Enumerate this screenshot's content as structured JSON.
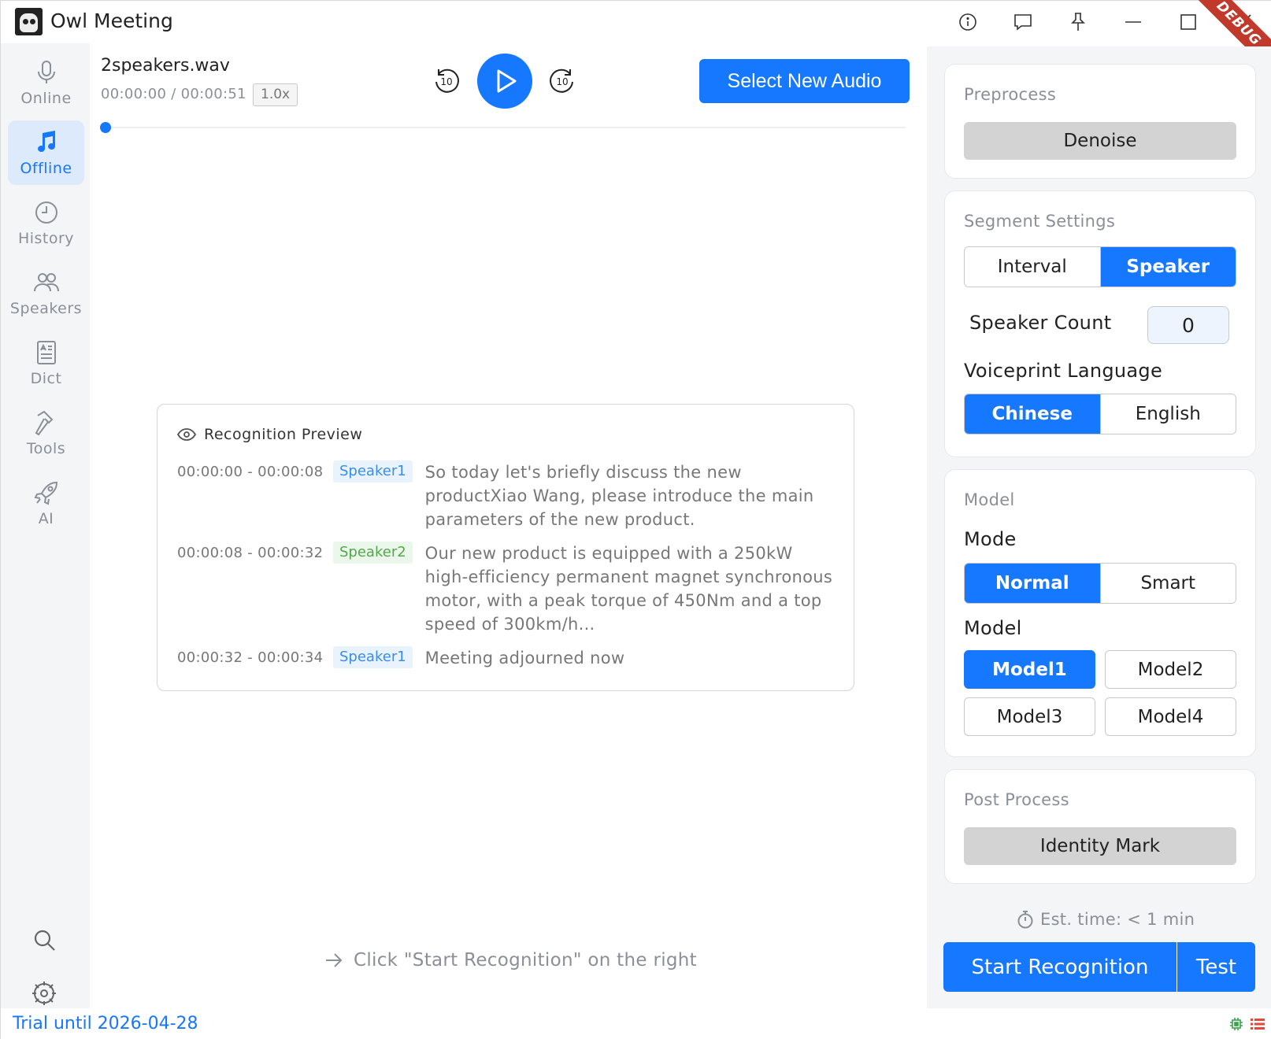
{
  "app": {
    "title": "Owl Meeting",
    "debug_label": "DEBUG"
  },
  "sidebar": {
    "items": [
      {
        "label": "Online",
        "icon": "microphone-icon",
        "active": false
      },
      {
        "label": "Offline",
        "icon": "music-note-icon",
        "active": true
      },
      {
        "label": "History",
        "icon": "clock-icon",
        "active": false
      },
      {
        "label": "Speakers",
        "icon": "users-icon",
        "active": false
      },
      {
        "label": "Dict",
        "icon": "dictionary-icon",
        "active": false
      },
      {
        "label": "Tools",
        "icon": "hammer-icon",
        "active": false
      },
      {
        "label": "AI",
        "icon": "rocket-icon",
        "active": false
      }
    ]
  },
  "player": {
    "file_name": "2speakers.wav",
    "time": "00:00:00 / 00:00:51",
    "speed": "1.0x",
    "skip_back_label": "10",
    "skip_forward_label": "10",
    "select_audio_label": "Select New Audio",
    "progress": 0
  },
  "preview": {
    "title": "Recognition Preview",
    "segments": [
      {
        "time": "00:00:00 - 00:00:08",
        "speaker": "Speaker1",
        "text": "So today let's briefly discuss the new productXiao Wang, please introduce the main parameters of the new product."
      },
      {
        "time": "00:00:08 - 00:00:32",
        "speaker": "Speaker2",
        "text": "Our new product is equipped with a 250kW high-efficiency permanent magnet synchronous motor, with a peak torque of 450Nm and a top speed of 300km/h..."
      },
      {
        "time": "00:00:32 - 00:00:34",
        "speaker": "Speaker1",
        "text": "Meeting adjourned now"
      }
    ]
  },
  "hint": "Click \"Start Recognition\" on the right",
  "panel": {
    "preprocess": {
      "title": "Preprocess",
      "denoise_label": "Denoise"
    },
    "segment": {
      "title": "Segment Settings",
      "options": [
        "Interval",
        "Speaker"
      ],
      "selected": "Speaker",
      "speaker_count_label": "Speaker Count",
      "speaker_count": "0",
      "voiceprint_label": "Voiceprint Language",
      "languages": [
        "Chinese",
        "English"
      ],
      "selected_language": "Chinese"
    },
    "model": {
      "title": "Model",
      "mode_label": "Mode",
      "modes": [
        "Normal",
        "Smart"
      ],
      "selected_mode": "Normal",
      "model_label": "Model",
      "models": [
        "Model1",
        "Model2",
        "Model3",
        "Model4"
      ],
      "selected_model": "Model1"
    },
    "post": {
      "title": "Post Process",
      "identity_label": "Identity Mark"
    },
    "est_time": "Est. time: < 1 min",
    "start_label": "Start Recognition",
    "test_label": "Test"
  },
  "status": {
    "trial": "Trial until 2026-04-28"
  },
  "colors": {
    "accent": "#1677ff",
    "speaker1": "#3a8ee6",
    "speaker2": "#52a84a"
  }
}
